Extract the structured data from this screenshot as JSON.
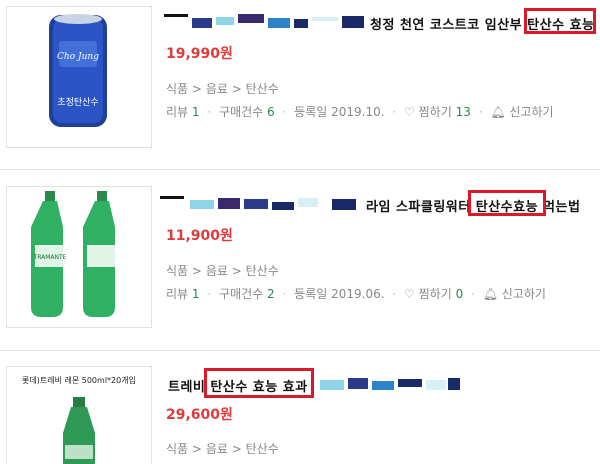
{
  "items": [
    {
      "title": "청정 천연 코스트코 임산부 탄산수 효능",
      "highlight": "탄산수 효능",
      "price": "19,990원",
      "category": [
        "식품",
        "음료",
        "탄산수"
      ],
      "review_label": "리뷰",
      "review_count": "1",
      "purchase_label": "구매건수",
      "purchase_count": "6",
      "date": "등록일 2019.10.",
      "wish_label": "찜하기",
      "wish_count": "13",
      "report_label": "신고하기",
      "thumb_brand": "초정탄산수",
      "thumb_color": "#1e3f9a"
    },
    {
      "title": "라임 스파클링워터 탄산수효능 먹는법",
      "highlight": "탄산수효능",
      "price": "11,900원",
      "category": [
        "식품",
        "음료",
        "탄산수"
      ],
      "review_label": "리뷰",
      "review_count": "1",
      "purchase_label": "구매건수",
      "purchase_count": "2",
      "date": "등록일 2019.06.",
      "wish_label": "찜하기",
      "wish_count": "0",
      "report_label": "신고하기",
      "thumb_brand": "TRAMANTE",
      "thumb_color": "#1e9a4a"
    },
    {
      "title": "트레비 탄산수 효능 효과",
      "highlight": "탄산수 효능 효과",
      "price": "29,600원",
      "category": [
        "식품",
        "음료",
        "탄산수"
      ],
      "thumb_caption": "롯데)트레비 레몬 500ml*20개입",
      "thumb_color": "#1e8a44"
    }
  ],
  "category_sep": ">",
  "icons": {
    "wish": "heart-icon",
    "report": "bell-icon"
  }
}
